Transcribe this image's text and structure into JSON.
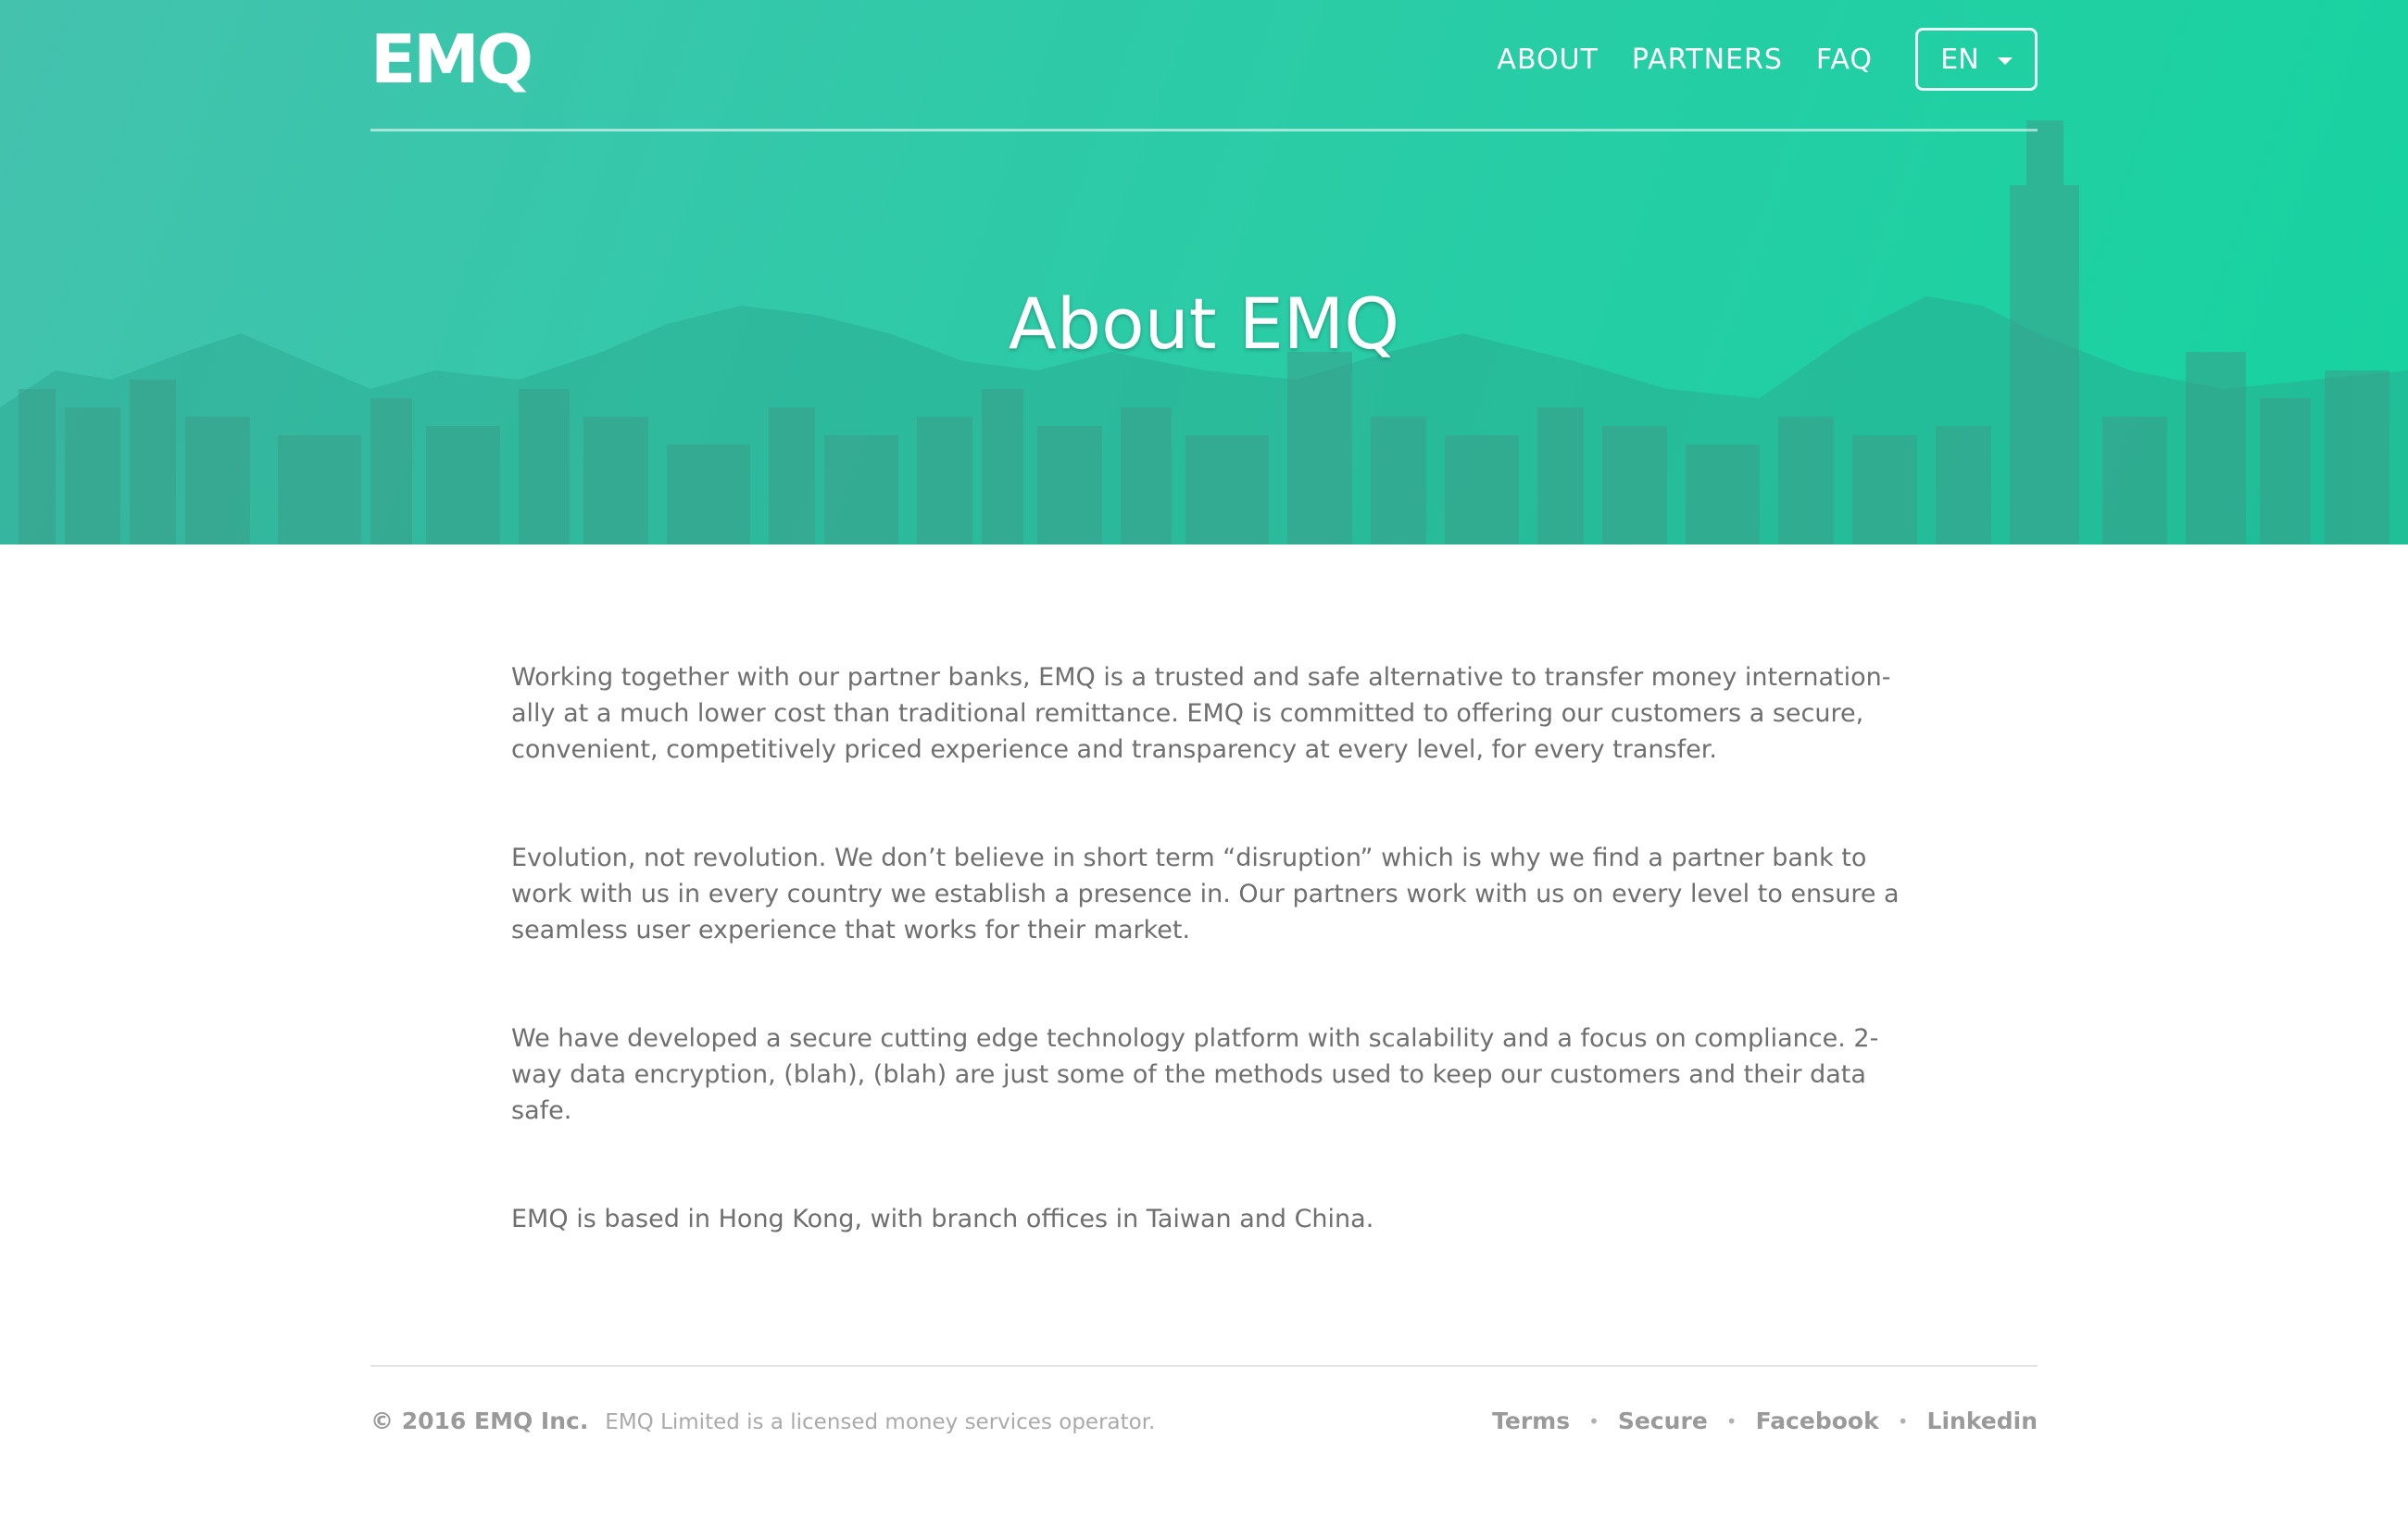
{
  "colors": {
    "accent": "#2fcaa8",
    "body_text": "#6f6f6f",
    "footer_text": "#9a9a9a"
  },
  "header": {
    "logo": "EMQ",
    "nav": [
      "ABOUT",
      "PARTNERS",
      "FAQ"
    ],
    "language": "EN"
  },
  "hero": {
    "title": "About EMQ"
  },
  "content": {
    "paragraphs": [
      "Working together with our partner banks, EMQ is a trusted and safe alternative to transfer money internation-ally at a much lower cost than traditional remittance. EMQ is committed to offering our customers a secure, convenient, competitively priced experience and transparency at every level, for every transfer.",
      "Evolution, not revolution. We don’t believe in short term “disruption” which is why we find a partner bank to work with us in every country we establish a presence in. Our partners work with us on every level to ensure a seamless user experience that works for their market.",
      "We have developed a secure cutting edge technology platform with scalability and a focus on compliance. 2-way data encryption, (blah), (blah) are just some of the methods used to keep our customers and their data safe.",
      "EMQ is based in Hong Kong, with branch offices in Taiwan and China."
    ]
  },
  "footer": {
    "copyright": "© 2016 EMQ Inc.",
    "license": "EMQ Limited is a licensed money services operator.",
    "links": [
      "Terms",
      "Secure",
      "Facebook",
      "Linkedin"
    ],
    "separator": "•"
  }
}
